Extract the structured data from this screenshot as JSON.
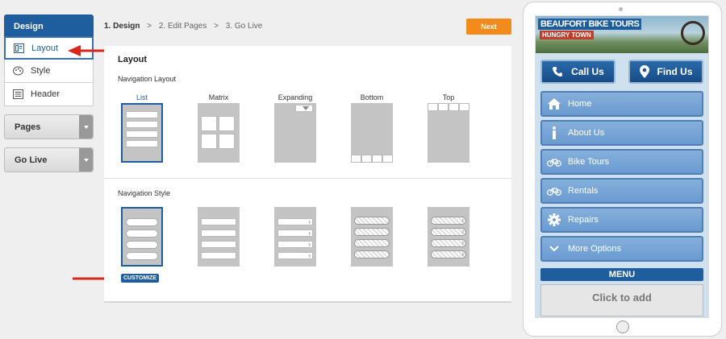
{
  "sidebar": {
    "header": "Design",
    "items": [
      {
        "label": "Layout",
        "icon": "layout-icon",
        "active": true
      },
      {
        "label": "Style",
        "icon": "palette-icon",
        "active": false
      },
      {
        "label": "Header",
        "icon": "header-icon",
        "active": false
      }
    ],
    "dropdowns": [
      {
        "label": "Pages"
      },
      {
        "label": "Go Live"
      }
    ]
  },
  "breadcrumb": {
    "step1": "1. Design",
    "sep": ">",
    "step2": "2. Edit Pages",
    "step3": "3. Go Live"
  },
  "next_button": "Next",
  "panel": {
    "title": "Layout",
    "nav_layout_title": "Navigation Layout",
    "nav_layout_options": [
      "List",
      "Matrix",
      "Expanding",
      "Bottom",
      "Top"
    ],
    "selected_layout": "List",
    "nav_style_title": "Navigation Style",
    "customize_label": "CUSTOMIZE"
  },
  "phone": {
    "banner_title": "BEAUFORT BIKE TOURS",
    "banner_subtitle": "HUNGRY TOWN",
    "cta": [
      {
        "label": "Call Us",
        "icon": "phone-icon"
      },
      {
        "label": "Find Us",
        "icon": "map-pin-icon"
      }
    ],
    "nav": [
      {
        "label": "Home",
        "icon": "home-icon"
      },
      {
        "label": "About Us",
        "icon": "info-icon"
      },
      {
        "label": "Bike Tours",
        "icon": "bicycle-icon"
      },
      {
        "label": "Rentals",
        "icon": "bicycle-icon"
      },
      {
        "label": "Repairs",
        "icon": "gear-icon"
      },
      {
        "label": "More Options",
        "icon": "chevron-down-icon"
      }
    ],
    "menu_label": "MENU",
    "click_to_add": "Click to add"
  },
  "colors": {
    "accent": "#1f5e9e",
    "next_button": "#f28a1c",
    "annotation_arrow": "#d9261c",
    "phone_nav": "#7aa7d8"
  }
}
